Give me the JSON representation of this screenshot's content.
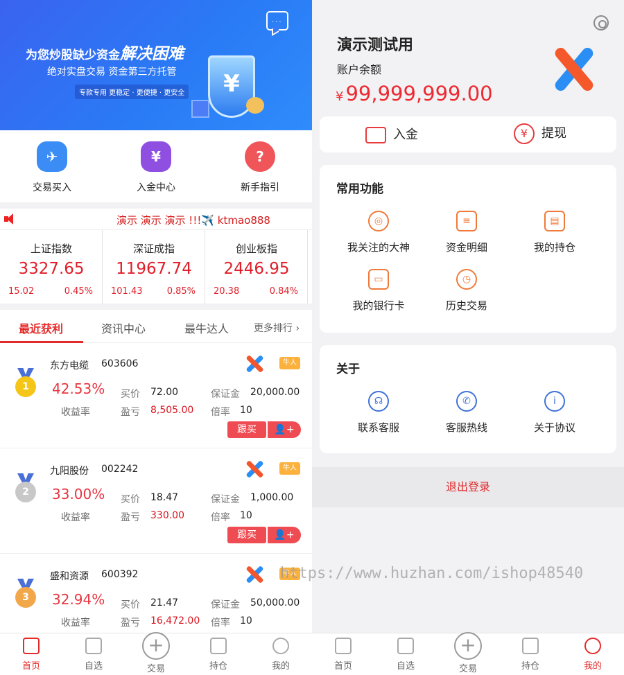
{
  "left": {
    "banner": {
      "line1": "为您炒股缺少资金",
      "line1_emph": "解决困难",
      "line2": "绝对实盘交易  资金第三方托管",
      "line3": "专款专用 更稳定 · 更便捷 · 更安全",
      "shield_symbol": "¥",
      "message_icon": "chat-bubble-icon"
    },
    "quick": [
      {
        "label": "交易买入",
        "icon": "paper-plane-icon",
        "glyph": "✈",
        "color": "#3b8cf5"
      },
      {
        "label": "入金中心",
        "icon": "yen-icon",
        "glyph": "¥",
        "color": "#8f4fe0"
      },
      {
        "label": "新手指引",
        "icon": "question-icon",
        "glyph": "?",
        "color": "#f0555a"
      }
    ],
    "ticker": "演示 演示 演示 !!!✈️ ktmao888",
    "indices": [
      {
        "name": "上证指数",
        "value": "3327.65",
        "change": "15.02",
        "pct": "0.45%"
      },
      {
        "name": "深证成指",
        "value": "11967.74",
        "change": "101.43",
        "pct": "0.85%"
      },
      {
        "name": "创业板指",
        "value": "2446.95",
        "change": "20.38",
        "pct": "0.84%"
      }
    ],
    "tabs": [
      "最近获利",
      "资讯中心",
      "最牛达人"
    ],
    "tabs_more": "更多排行",
    "labels": {
      "rate": "收益率",
      "buy": "买价",
      "pnl": "盈亏",
      "margin": "保证金",
      "multiple": "倍率",
      "follow": "跟买",
      "add": "+",
      "badge": "牛人"
    },
    "rows": [
      {
        "rank": "1",
        "medal_color": "#f5c518",
        "name": "东方电缆",
        "code": "603606",
        "rate": "42.53%",
        "buy": "72.00",
        "pnl": "8,505.00",
        "margin": "20,000.00",
        "multiple": "10"
      },
      {
        "rank": "2",
        "medal_color": "#c8c8c8",
        "name": "九阳股份",
        "code": "002242",
        "rate": "33.00%",
        "buy": "18.47",
        "pnl": "330.00",
        "margin": "1,000.00",
        "multiple": "10"
      },
      {
        "rank": "3",
        "medal_color": "#f2a84a",
        "name": "盛和资源",
        "code": "600392",
        "rate": "32.94%",
        "buy": "21.47",
        "pnl": "16,472.00",
        "margin": "50,000.00",
        "multiple": "10"
      }
    ],
    "nav": [
      {
        "label": "首页",
        "icon": "home-icon",
        "active": true
      },
      {
        "label": "自选",
        "icon": "chart-icon",
        "active": false
      },
      {
        "label": "交易",
        "icon": "plus-circle-icon",
        "active": false
      },
      {
        "label": "持仓",
        "icon": "bar-chart-icon",
        "active": false
      },
      {
        "label": "我的",
        "icon": "user-icon",
        "active": false
      }
    ]
  },
  "right": {
    "title": "演示测试用",
    "balance_label": "账户余额",
    "currency": "¥",
    "balance": "99,999,999.00",
    "deposit": "入金",
    "withdraw": "提现",
    "common_title": "常用功能",
    "common": [
      {
        "label": "我关注的大神",
        "icon": "target-icon",
        "glyph": "◎"
      },
      {
        "label": "资金明细",
        "icon": "search-list-icon",
        "glyph": "≡"
      },
      {
        "label": "我的持仓",
        "icon": "document-icon",
        "glyph": "▤"
      },
      {
        "label": "我的银行卡",
        "icon": "card-icon",
        "glyph": "▭"
      },
      {
        "label": "历史交易",
        "icon": "clock-icon",
        "glyph": "◷"
      }
    ],
    "about_title": "关于",
    "about": [
      {
        "label": "联系客服",
        "icon": "headset-icon",
        "glyph": "☊"
      },
      {
        "label": "客服热线",
        "icon": "phone-icon",
        "glyph": "✆"
      },
      {
        "label": "关于协议",
        "icon": "info-icon",
        "glyph": "i"
      }
    ],
    "logout": "退出登录",
    "nav": [
      {
        "label": "首页",
        "icon": "home-icon",
        "active": false
      },
      {
        "label": "自选",
        "icon": "chart-icon",
        "active": false
      },
      {
        "label": "交易",
        "icon": "plus-circle-icon",
        "active": false
      },
      {
        "label": "持仓",
        "icon": "bar-chart-icon",
        "active": false
      },
      {
        "label": "我的",
        "icon": "user-icon",
        "active": true
      }
    ]
  },
  "watermark": "https://www.huzhan.com/ishop48540"
}
